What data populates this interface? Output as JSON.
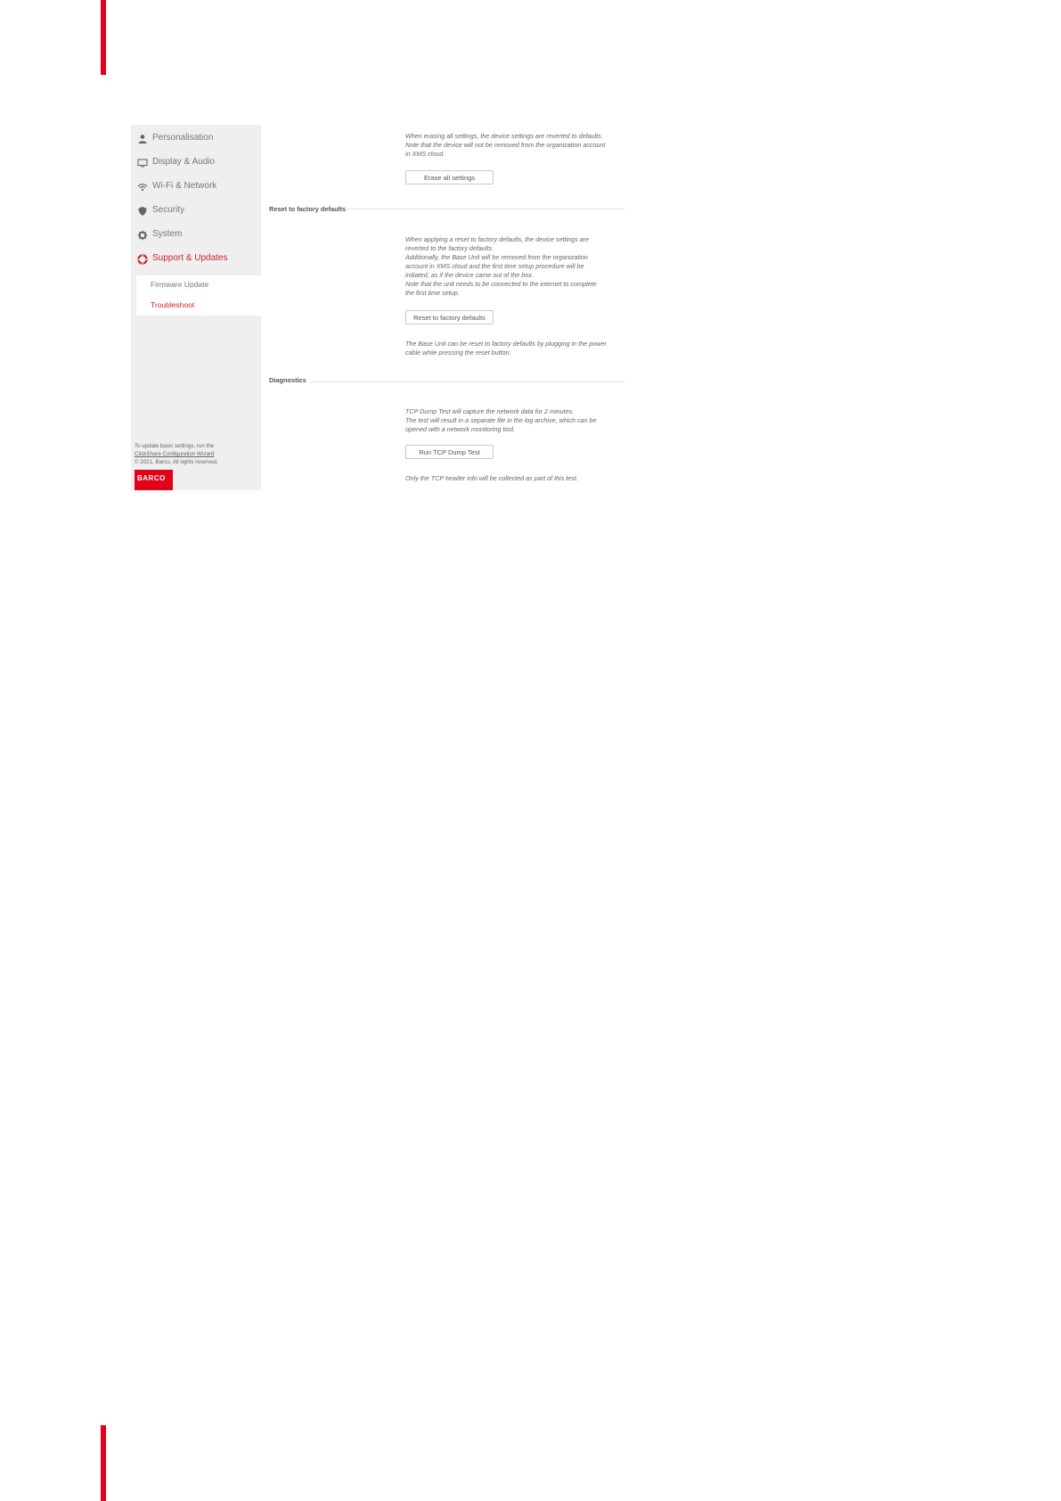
{
  "sidebar": {
    "items": [
      {
        "label": "Personalisation",
        "icon": "person-icon"
      },
      {
        "label": "Display & Audio",
        "icon": "monitor-icon"
      },
      {
        "label": "Wi-Fi & Network",
        "icon": "wifi-icon"
      },
      {
        "label": "Security",
        "icon": "shield-icon"
      },
      {
        "label": "System",
        "icon": "gear-icon"
      },
      {
        "label": "Support & Updates",
        "icon": "lifebuoy-icon",
        "active": true
      }
    ],
    "subitems": [
      {
        "label": "Firmware Update"
      },
      {
        "label": "Troubleshoot",
        "active": true
      }
    ],
    "footer": {
      "line1": "To update basic settings, run the",
      "link": "ClickShare Configuration Wizard",
      "copyright": "© 2021, Barco. All rights reserved."
    },
    "logo_text": "BARCO"
  },
  "main": {
    "erase": {
      "line1": "When erasing all settings, the device settings are reverted to defaults.",
      "line2": "Note that the device will not be removed from the organization account",
      "line3": "in XMS cloud.",
      "button": "Erase all settings"
    },
    "reset": {
      "title": "Reset to factory defaults",
      "lines": [
        "When applying a reset to factory defaults, the device settings are",
        "reverted to the factory defaults.",
        "Additionally, the Base Unit will be removed from the organization",
        "account in XMS cloud and the first time setup procedure will be",
        "initiated, as if the device came out of the box.",
        "Note that the unit needs to be connected to the internet to complete",
        "the first time setup."
      ],
      "button": "Reset to factory defaults",
      "note_line1": "The Base Unit can be reset to factory defaults by plugging in the power",
      "note_line2": "cable while pressing the reset button."
    },
    "diagnostics": {
      "title": "Diagnostics",
      "line1": "TCP Dump Test will capture the network data for 2 minutes.",
      "line2": "The test will result in a separate file in the log archive, which can be",
      "line3": "opened with a network monitoring tool.",
      "button": "Run TCP Dump Test",
      "note": "Only the TCP header info will be collected as part of this test."
    }
  },
  "colors": {
    "accent": "#e2001a",
    "active_text": "#d0222a",
    "sidebar_bg": "#efefef"
  }
}
